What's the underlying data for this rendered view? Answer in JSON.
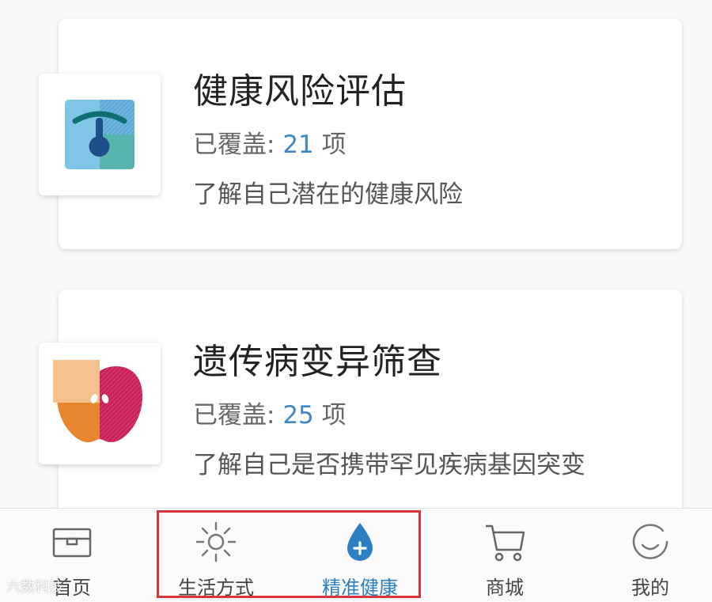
{
  "cards": [
    {
      "title": "健康风险评估",
      "meta_prefix": "已覆盖: ",
      "count": "21",
      "meta_suffix": " 项",
      "desc": "了解自己潜在的健康风险",
      "icon": "health-risk-gauge-icon"
    },
    {
      "title": "遗传病变异筛查",
      "meta_prefix": "已覆盖: ",
      "count": "25",
      "meta_suffix": " 项",
      "desc": "了解自己是否携带罕见疾病基因突变",
      "icon": "genetic-apple-icon"
    }
  ],
  "tabbar": {
    "items": [
      {
        "label": "首页",
        "icon": "home-box-icon",
        "active": false
      },
      {
        "label": "生活方式",
        "icon": "sun-icon",
        "active": false
      },
      {
        "label": "精准健康",
        "icon": "drop-plus-icon",
        "active": true
      },
      {
        "label": "商城",
        "icon": "cart-icon",
        "active": false
      },
      {
        "label": "我的",
        "icon": "smile-icon",
        "active": false
      }
    ]
  },
  "watermark": "六数科技",
  "colors": {
    "accent": "#2c7fc4",
    "count": "#3f86c8",
    "highlight": "#d9363a"
  }
}
